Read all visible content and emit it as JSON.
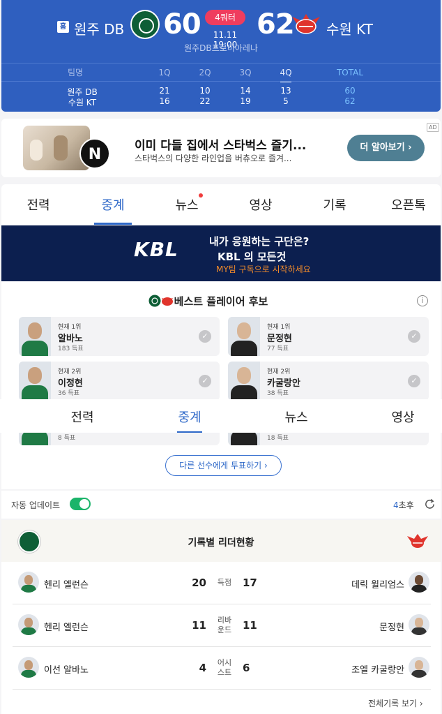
{
  "scoreboard": {
    "home_badge": "홈",
    "home_team": "원주 DB",
    "home_score": "60",
    "away_team": "수원 KT",
    "away_score": "62",
    "quarter": "4쿼터",
    "time": "11.11 19:00",
    "venue": "원주DB프로미아레나",
    "table": {
      "headers": [
        "팀명",
        "1Q",
        "2Q",
        "3Q",
        "4Q",
        "TOTAL"
      ],
      "rows": [
        {
          "team": "원주 DB",
          "q": [
            "21",
            "10",
            "14",
            "13"
          ],
          "total": "60"
        },
        {
          "team": "수원 KT",
          "q": [
            "16",
            "22",
            "19",
            "5"
          ],
          "total": "62"
        }
      ]
    }
  },
  "ad": {
    "title": "이미 다들 집에서 스타벅스 즐기...",
    "subtitle": "스타벅스의 다양한 라인업을 버츄오로 즐겨...",
    "button": "더 알아보기 ›",
    "mark": "AD",
    "logo_letter": "N"
  },
  "tabs": [
    "전력",
    "중계",
    "뉴스",
    "영상",
    "기록",
    "오픈톡"
  ],
  "sticky_tabs": [
    "전력",
    "중계",
    "뉴스",
    "영상"
  ],
  "kbl_banner": {
    "logo": "KBL",
    "line1": "내가 응원하는 구단은?",
    "line2": "KBL 의 모든것",
    "line3": "MY팀 구독으로 시작하세요"
  },
  "best_player": {
    "title": "베스트 플레이어 후보",
    "info": "i",
    "cards": [
      {
        "rank": "현재 1위",
        "name": "알바노",
        "votes": "183 득표"
      },
      {
        "rank": "현재 1위",
        "name": "문정현",
        "votes": "77 득표"
      },
      {
        "rank": "현재 2위",
        "name": "이정현",
        "votes": "36 득표"
      },
      {
        "rank": "현재 2위",
        "name": "카굴랑안",
        "votes": "38 득표"
      },
      {
        "rank": "",
        "name": "",
        "votes": "8 득표"
      },
      {
        "rank": "",
        "name": "",
        "votes": "18 득표"
      }
    ],
    "vote_button": "다른 선수에게 투표하기 ›"
  },
  "auto_update": {
    "label": "자동 업데이트",
    "countdown_num": "4",
    "countdown_unit": "초후",
    "enabled": true
  },
  "leaders": {
    "title": "기록별 리더현황",
    "rows": [
      {
        "home_player": "헨리 엘런슨",
        "home_value": "20",
        "category": "득점",
        "away_value": "17",
        "away_player": "데릭 윌리엄스"
      },
      {
        "home_player": "헨리 엘런슨",
        "home_value": "11",
        "category": "리바운드",
        "away_value": "11",
        "away_player": "문정현"
      },
      {
        "home_player": "이선 알바노",
        "home_value": "4",
        "category": "어시스트",
        "away_value": "6",
        "away_player": "조엘 카굴랑안"
      }
    ],
    "all_records": "전체기록 보기 ›"
  },
  "colors": {
    "header_bg": "#2f5fbf",
    "accent": "#2e68c8",
    "quarter_pill": "#ef3d5e",
    "toggle_on": "#1bb46a"
  }
}
